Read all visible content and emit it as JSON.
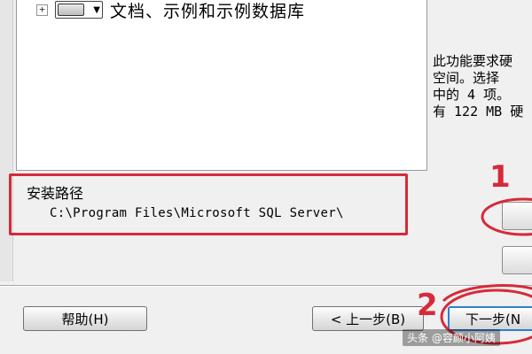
{
  "tree": {
    "expander": "+",
    "item_label": "文档、示例和示例数据库"
  },
  "description": {
    "lines": [
      "此功能要求硬",
      "空间。选择",
      "中的 4 项。",
      "有 122 MB 硬"
    ]
  },
  "install_path": {
    "title": "安装路径",
    "value": "C:\\Program Files\\Microsoft SQL Server\\"
  },
  "buttons": {
    "help": "帮助(H)",
    "back": "< 上一步(B)",
    "next": "下一步(N"
  },
  "annotations": {
    "one": "1",
    "two": "2",
    "color": "#d62a3a"
  },
  "watermark": "头条 @容颜小阿姨"
}
